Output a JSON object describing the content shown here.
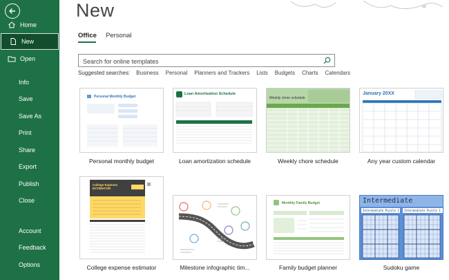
{
  "sidebar": {
    "items": [
      {
        "label": "Home",
        "icon": "home-icon"
      },
      {
        "label": "New",
        "icon": "new-document-icon",
        "active": true
      },
      {
        "label": "Open",
        "icon": "folder-icon"
      },
      {
        "label": "Info"
      },
      {
        "label": "Save"
      },
      {
        "label": "Save As"
      },
      {
        "label": "Print"
      },
      {
        "label": "Share"
      },
      {
        "label": "Export"
      },
      {
        "label": "Publish"
      },
      {
        "label": "Close"
      },
      {
        "label": "Account"
      },
      {
        "label": "Feedback"
      },
      {
        "label": "Options"
      }
    ]
  },
  "main": {
    "title": "New",
    "tabs": [
      {
        "label": "Office",
        "active": true
      },
      {
        "label": "Personal"
      }
    ],
    "search": {
      "placeholder": "Search for online templates"
    },
    "suggested": {
      "label": "Suggested searches:",
      "items": [
        "Business",
        "Personal",
        "Planners and Trackers",
        "Lists",
        "Budgets",
        "Charts",
        "Calendars"
      ]
    },
    "templates": [
      {
        "caption": "Personal monthly budget",
        "thumb_title": "Personal Monthly Budget"
      },
      {
        "caption": "Loan amortization schedule",
        "thumb_title": "Loan Amortization Schedule"
      },
      {
        "caption": "Weekly chore schedule",
        "thumb_title": "Weekly chore schedule"
      },
      {
        "caption": "Any year custom calendar",
        "thumb_title": "January 20XX"
      },
      {
        "caption": "College expense estimator",
        "thumb_title": "College Expense ESTIMATOR"
      },
      {
        "caption": "Milestone infographic tim...",
        "thumb_title": ""
      },
      {
        "caption": "Family budget planner",
        "thumb_title": "Monthly Family Budget"
      },
      {
        "caption": "Sudoku game",
        "thumb_title": "Intermediate",
        "thumb_sub": "Intermediate Puzzle 1"
      }
    ]
  },
  "colors": {
    "sidebar": "#1e7145",
    "sidebar_active": "#124d2d",
    "accent": "#1e7145"
  }
}
